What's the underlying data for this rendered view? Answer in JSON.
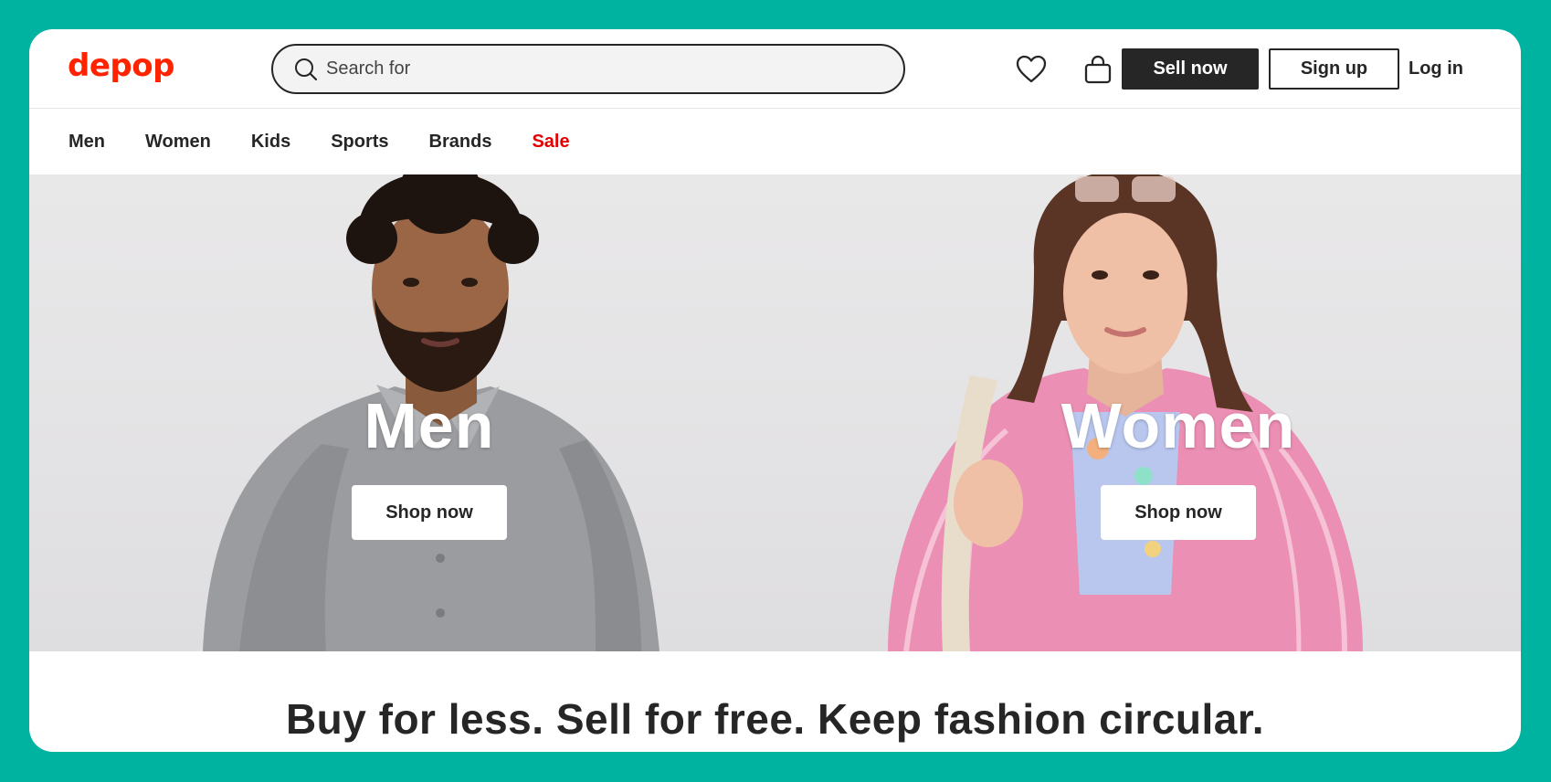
{
  "brand": {
    "logo": "depop",
    "logo_color": "#ff2300"
  },
  "search": {
    "placeholder": "Search for"
  },
  "header": {
    "sell_label": "Sell now",
    "signup_label": "Sign up",
    "login_label": "Log in"
  },
  "nav": {
    "items": [
      {
        "label": "Men"
      },
      {
        "label": "Women"
      },
      {
        "label": "Kids"
      },
      {
        "label": "Sports"
      },
      {
        "label": "Brands"
      },
      {
        "label": "Sale",
        "color": "#e40000"
      }
    ]
  },
  "hero": {
    "men": {
      "title": "Men",
      "button": "Shop now"
    },
    "women": {
      "title": "Women",
      "button": "Shop now"
    }
  },
  "tagline": "Buy for less. Sell for free. Keep fashion circular.",
  "colors": {
    "background": "#00b3a1",
    "dark": "#262626",
    "sale": "#e40000"
  }
}
